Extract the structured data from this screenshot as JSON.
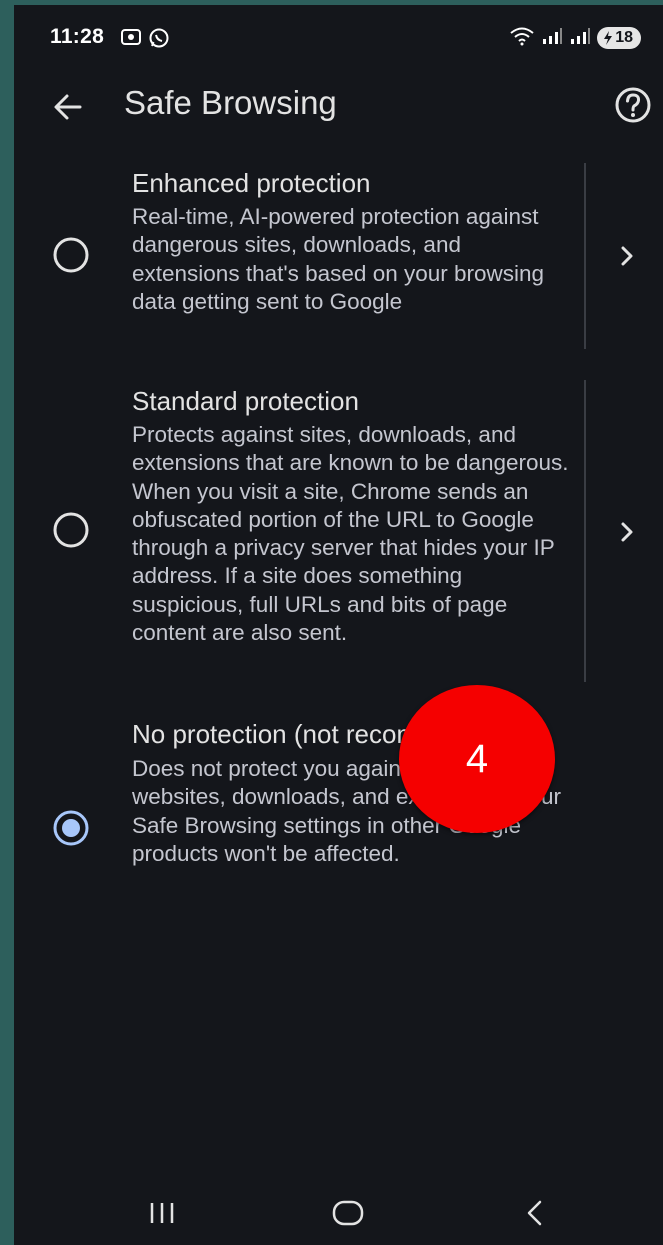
{
  "status_bar": {
    "time": "11:28",
    "battery": "18",
    "notification_icons": [
      "screenshot-icon",
      "whatsapp-icon"
    ],
    "system_icons": [
      "wifi-icon",
      "signal-icon",
      "signal-icon",
      "battery-icon"
    ]
  },
  "app_bar": {
    "title": "Safe Browsing",
    "back_icon": "arrow-left-icon",
    "help_icon": "help-circle-icon"
  },
  "options": [
    {
      "title": "Enhanced protection",
      "description": "Real-time, AI-powered protection against dangerous sites, downloads, and extensions that's based on your browsing data getting sent to Google",
      "selected": false,
      "has_details": true
    },
    {
      "title": "Standard protection",
      "description": "Protects against sites, downloads, and extensions that are known to be dangerous. When you visit a site, Chrome sends an obfuscated portion of the URL to Google through a privacy server that hides your IP address. If a site does something suspicious, full URLs and bits of page content are also sent.",
      "selected": false,
      "has_details": true
    },
    {
      "title": "No protection (not recommended)",
      "description": "Does not protect you against dangerous websites, downloads, and extensions. Your Safe Browsing settings in other Google products won't be affected.",
      "selected": true,
      "has_details": false
    }
  ],
  "overlay_badge": {
    "label": "4",
    "color": "#f50000"
  },
  "nav_bar": {
    "icons": [
      "recents-icon",
      "home-icon",
      "back-icon"
    ]
  },
  "colors": {
    "background": "#14161b",
    "text": "#e3e3e3",
    "accent": "#a8c7fa"
  }
}
